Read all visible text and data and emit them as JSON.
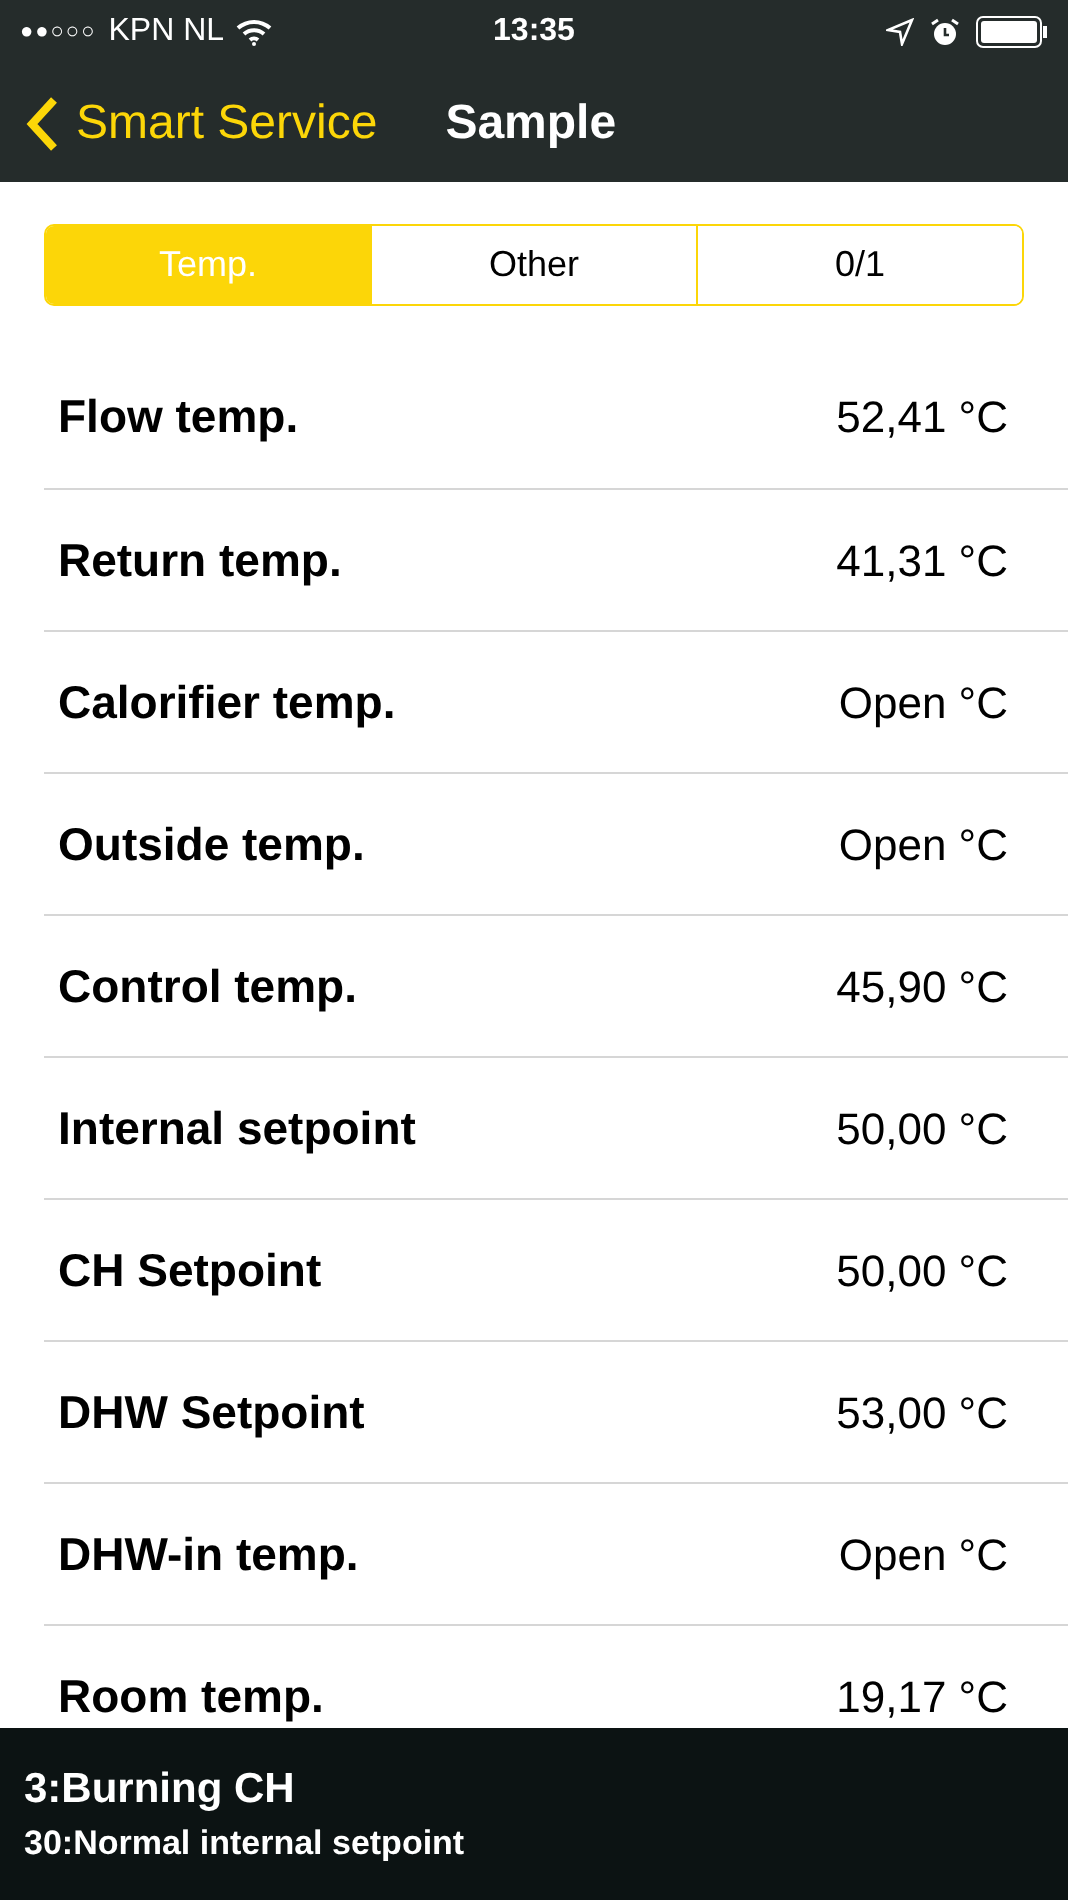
{
  "status_bar": {
    "signal_dots": "●●○○○",
    "carrier": "KPN NL",
    "time": "13:35"
  },
  "nav": {
    "back_label": "Smart Service",
    "title": "Sample"
  },
  "tabs": [
    {
      "label": "Temp.",
      "selected": true
    },
    {
      "label": "Other",
      "selected": false
    },
    {
      "label": "0/1",
      "selected": false
    }
  ],
  "rows": [
    {
      "label": "Flow temp.",
      "value": "52,41 °C"
    },
    {
      "label": "Return temp.",
      "value": "41,31 °C"
    },
    {
      "label": "Calorifier temp.",
      "value": "Open °C"
    },
    {
      "label": "Outside temp.",
      "value": "Open °C"
    },
    {
      "label": "Control temp.",
      "value": "45,90 °C"
    },
    {
      "label": "Internal setpoint",
      "value": "50,00 °C"
    },
    {
      "label": "CH Setpoint",
      "value": "50,00 °C"
    },
    {
      "label": "DHW Setpoint",
      "value": "53,00 °C"
    },
    {
      "label": "DHW-in temp.",
      "value": "Open °C"
    },
    {
      "label": "Room temp.",
      "value": "19,17 °C"
    }
  ],
  "status_overlay": {
    "state": "3:Burning CH",
    "substate": "30:Normal internal setpoint"
  }
}
